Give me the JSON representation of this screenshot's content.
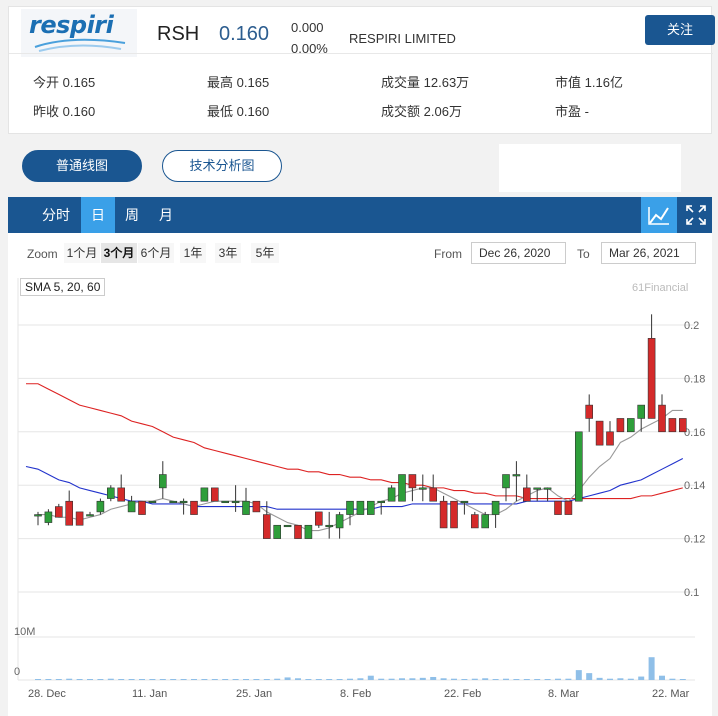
{
  "header": {
    "logo_text": "respiri",
    "ticker": "RSH",
    "price": "0.160",
    "change": "0.000",
    "change_pct": "0.00%",
    "company": "RESPIRI LIMITED",
    "follow_label": "关注",
    "stats": [
      {
        "label": "今开",
        "value": "0.165"
      },
      {
        "label": "最高",
        "value": "0.165"
      },
      {
        "label": "成交量",
        "value": "12.63万"
      },
      {
        "label": "市值",
        "value": "1.16亿"
      },
      {
        "label": "昨收",
        "value": "0.160"
      },
      {
        "label": "最低",
        "value": "0.160"
      },
      {
        "label": "成交额",
        "value": "2.06万"
      },
      {
        "label": "市盈",
        "value": "-"
      }
    ]
  },
  "chart_type_buttons": [
    "普通线图",
    "技术分析图"
  ],
  "nav": {
    "tabs": [
      "分时",
      "日",
      "周",
      "月"
    ],
    "selected": "日",
    "icons": [
      "line-chart-icon",
      "fullscreen-icon"
    ]
  },
  "zoom": {
    "label": "Zoom",
    "options": [
      "1个月",
      "3个月",
      "6个月",
      "1年",
      "3年",
      "5年"
    ],
    "selected": "3个月",
    "from_label": "From",
    "from_value": "Dec 26, 2020",
    "to_label": "To",
    "to_value": "Mar 26, 2021"
  },
  "indicator_label": "SMA 5, 20, 60",
  "credit": "61Financial",
  "colors": {
    "up": "#2e9e3a",
    "down": "#d42a2a",
    "brand": "#1a5691",
    "accent": "#3aa0e8",
    "sma5": "#999999",
    "sma20": "#2233cc",
    "sma60": "#dd2222",
    "volume": "#8fbfe8"
  },
  "chart_data": {
    "type": "candlestick",
    "x_ticks": [
      "28. Dec",
      "11. Jan",
      "25. Jan",
      "8. Feb",
      "22. Feb",
      "8. Mar",
      "22. Mar"
    ],
    "y_ticks": [
      "0.2",
      "0.18",
      "0.16",
      "0.14",
      "0.12",
      "0.1"
    ],
    "ylim": [
      0.1,
      0.21
    ],
    "volume_ticks": [
      "10M",
      "0"
    ],
    "volume_max": 10,
    "candles": [
      {
        "o": 0.129,
        "h": 0.13,
        "l": 0.125,
        "c": 0.129
      },
      {
        "o": 0.126,
        "h": 0.131,
        "l": 0.125,
        "c": 0.13
      },
      {
        "o": 0.132,
        "h": 0.133,
        "l": 0.128,
        "c": 0.128
      },
      {
        "o": 0.134,
        "h": 0.138,
        "l": 0.125,
        "c": 0.125
      },
      {
        "o": 0.13,
        "h": 0.13,
        "l": 0.125,
        "c": 0.125
      },
      {
        "o": 0.129,
        "h": 0.13,
        "l": 0.129,
        "c": 0.129
      },
      {
        "o": 0.13,
        "h": 0.135,
        "l": 0.129,
        "c": 0.134
      },
      {
        "o": 0.135,
        "h": 0.14,
        "l": 0.134,
        "c": 0.139
      },
      {
        "o": 0.139,
        "h": 0.144,
        "l": 0.134,
        "c": 0.134
      },
      {
        "o": 0.13,
        "h": 0.136,
        "l": 0.13,
        "c": 0.134
      },
      {
        "o": 0.134,
        "h": 0.134,
        "l": 0.129,
        "c": 0.129
      },
      {
        "o": 0.134,
        "h": 0.134,
        "l": 0.134,
        "c": 0.134
      },
      {
        "o": 0.139,
        "h": 0.149,
        "l": 0.135,
        "c": 0.144
      },
      {
        "o": 0.134,
        "h": 0.134,
        "l": 0.134,
        "c": 0.134
      },
      {
        "o": 0.134,
        "h": 0.135,
        "l": 0.129,
        "c": 0.134
      },
      {
        "o": 0.134,
        "h": 0.134,
        "l": 0.129,
        "c": 0.129
      },
      {
        "o": 0.134,
        "h": 0.139,
        "l": 0.134,
        "c": 0.139
      },
      {
        "o": 0.139,
        "h": 0.139,
        "l": 0.134,
        "c": 0.134
      },
      {
        "o": 0.134,
        "h": 0.134,
        "l": 0.134,
        "c": 0.134
      },
      {
        "o": 0.134,
        "h": 0.14,
        "l": 0.13,
        "c": 0.134
      },
      {
        "o": 0.129,
        "h": 0.139,
        "l": 0.129,
        "c": 0.134
      },
      {
        "o": 0.134,
        "h": 0.134,
        "l": 0.13,
        "c": 0.13
      },
      {
        "o": 0.129,
        "h": 0.134,
        "l": 0.12,
        "c": 0.12
      },
      {
        "o": 0.12,
        "h": 0.125,
        "l": 0.12,
        "c": 0.125
      },
      {
        "o": 0.125,
        "h": 0.125,
        "l": 0.125,
        "c": 0.125
      },
      {
        "o": 0.125,
        "h": 0.125,
        "l": 0.12,
        "c": 0.12
      },
      {
        "o": 0.12,
        "h": 0.125,
        "l": 0.12,
        "c": 0.125
      },
      {
        "o": 0.13,
        "h": 0.13,
        "l": 0.124,
        "c": 0.125
      },
      {
        "o": 0.125,
        "h": 0.13,
        "l": 0.12,
        "c": 0.125
      },
      {
        "o": 0.124,
        "h": 0.13,
        "l": 0.12,
        "c": 0.129
      },
      {
        "o": 0.129,
        "h": 0.134,
        "l": 0.125,
        "c": 0.134
      },
      {
        "o": 0.129,
        "h": 0.134,
        "l": 0.129,
        "c": 0.134
      },
      {
        "o": 0.129,
        "h": 0.134,
        "l": 0.129,
        "c": 0.134
      },
      {
        "o": 0.134,
        "h": 0.134,
        "l": 0.129,
        "c": 0.134
      },
      {
        "o": 0.134,
        "h": 0.14,
        "l": 0.134,
        "c": 0.139
      },
      {
        "o": 0.134,
        "h": 0.144,
        "l": 0.134,
        "c": 0.144
      },
      {
        "o": 0.144,
        "h": 0.144,
        "l": 0.134,
        "c": 0.139
      },
      {
        "o": 0.139,
        "h": 0.144,
        "l": 0.134,
        "c": 0.139
      },
      {
        "o": 0.139,
        "h": 0.144,
        "l": 0.134,
        "c": 0.134
      },
      {
        "o": 0.134,
        "h": 0.136,
        "l": 0.124,
        "c": 0.124
      },
      {
        "o": 0.134,
        "h": 0.134,
        "l": 0.124,
        "c": 0.124
      },
      {
        "o": 0.134,
        "h": 0.134,
        "l": 0.129,
        "c": 0.134
      },
      {
        "o": 0.129,
        "h": 0.13,
        "l": 0.124,
        "c": 0.124
      },
      {
        "o": 0.124,
        "h": 0.13,
        "l": 0.124,
        "c": 0.129
      },
      {
        "o": 0.129,
        "h": 0.134,
        "l": 0.124,
        "c": 0.134
      },
      {
        "o": 0.139,
        "h": 0.144,
        "l": 0.134,
        "c": 0.144
      },
      {
        "o": 0.144,
        "h": 0.149,
        "l": 0.134,
        "c": 0.144
      },
      {
        "o": 0.139,
        "h": 0.144,
        "l": 0.134,
        "c": 0.134
      },
      {
        "o": 0.139,
        "h": 0.139,
        "l": 0.134,
        "c": 0.139
      },
      {
        "o": 0.139,
        "h": 0.139,
        "l": 0.134,
        "c": 0.139
      },
      {
        "o": 0.134,
        "h": 0.134,
        "l": 0.129,
        "c": 0.129
      },
      {
        "o": 0.134,
        "h": 0.134,
        "l": 0.129,
        "c": 0.129
      },
      {
        "o": 0.134,
        "h": 0.16,
        "l": 0.134,
        "c": 0.16
      },
      {
        "o": 0.17,
        "h": 0.174,
        "l": 0.16,
        "c": 0.165
      },
      {
        "o": 0.164,
        "h": 0.164,
        "l": 0.155,
        "c": 0.155
      },
      {
        "o": 0.16,
        "h": 0.164,
        "l": 0.155,
        "c": 0.155
      },
      {
        "o": 0.165,
        "h": 0.165,
        "l": 0.16,
        "c": 0.16
      },
      {
        "o": 0.16,
        "h": 0.165,
        "l": 0.16,
        "c": 0.165
      },
      {
        "o": 0.165,
        "h": 0.17,
        "l": 0.16,
        "c": 0.17
      },
      {
        "o": 0.195,
        "h": 0.204,
        "l": 0.165,
        "c": 0.165
      },
      {
        "o": 0.17,
        "h": 0.174,
        "l": 0.16,
        "c": 0.16
      },
      {
        "o": 0.165,
        "h": 0.165,
        "l": 0.16,
        "c": 0.16
      },
      {
        "o": 0.165,
        "h": 0.165,
        "l": 0.16,
        "c": 0.16
      }
    ],
    "volumes": [
      0.05,
      0.05,
      0.1,
      0.3,
      0.05,
      0.05,
      0.2,
      0.3,
      0.1,
      0.05,
      0.1,
      0.05,
      0.2,
      0.05,
      0.1,
      0.2,
      0.1,
      0.1,
      0.05,
      0.05,
      0.1,
      0.2,
      0.2,
      0.3,
      0.6,
      0.4,
      0.1,
      0.1,
      0.05,
      0.1,
      0.3,
      0.4,
      1.0,
      0.3,
      0.3,
      0.4,
      0.4,
      0.5,
      0.7,
      0.4,
      0.3,
      0.2,
      0.3,
      0.4,
      0.2,
      0.3,
      0.2,
      0.05,
      0.2,
      0.2,
      0.3,
      0.3,
      2.3,
      1.6,
      0.5,
      0.3,
      0.4,
      0.3,
      0.8,
      5.3,
      1.0,
      0.3,
      0.2
    ],
    "sma5": [
      0.129,
      0.129,
      0.128,
      0.128,
      0.127,
      0.128,
      0.129,
      0.131,
      0.132,
      0.133,
      0.134,
      0.134,
      0.135,
      0.134,
      0.133,
      0.132,
      0.133,
      0.134,
      0.134,
      0.134,
      0.134,
      0.133,
      0.13,
      0.128,
      0.126,
      0.125,
      0.123,
      0.123,
      0.124,
      0.126,
      0.128,
      0.13,
      0.132,
      0.134,
      0.135,
      0.137,
      0.138,
      0.139,
      0.139,
      0.137,
      0.135,
      0.133,
      0.131,
      0.129,
      0.129,
      0.131,
      0.134,
      0.136,
      0.138,
      0.139,
      0.136,
      0.134,
      0.138,
      0.143,
      0.147,
      0.15,
      0.156,
      0.158,
      0.161,
      0.163,
      0.165,
      0.168,
      0.168
    ],
    "sma20": [
      0.146,
      0.144,
      0.142,
      0.141,
      0.139,
      0.138,
      0.137,
      0.136,
      0.135,
      0.134,
      0.134,
      0.133,
      0.133,
      0.133,
      0.133,
      0.132,
      0.132,
      0.132,
      0.132,
      0.132,
      0.132,
      0.132,
      0.132,
      0.131,
      0.131,
      0.131,
      0.131,
      0.131,
      0.131,
      0.131,
      0.131,
      0.131,
      0.131,
      0.132,
      0.132,
      0.132,
      0.133,
      0.133,
      0.133,
      0.133,
      0.133,
      0.133,
      0.133,
      0.133,
      0.133,
      0.133,
      0.133,
      0.134,
      0.134,
      0.134,
      0.134,
      0.134,
      0.135,
      0.136,
      0.137,
      0.138,
      0.14,
      0.141,
      0.142,
      0.144,
      0.146,
      0.148,
      0.15
    ],
    "sma60": [
      0.178,
      0.176,
      0.174,
      0.172,
      0.17,
      0.169,
      0.168,
      0.167,
      0.166,
      0.164,
      0.163,
      0.162,
      0.16,
      0.158,
      0.157,
      0.156,
      0.154,
      0.153,
      0.152,
      0.151,
      0.15,
      0.149,
      0.148,
      0.147,
      0.146,
      0.146,
      0.145,
      0.145,
      0.144,
      0.144,
      0.143,
      0.143,
      0.142,
      0.142,
      0.141,
      0.141,
      0.14,
      0.14,
      0.139,
      0.139,
      0.138,
      0.138,
      0.137,
      0.137,
      0.136,
      0.136,
      0.136,
      0.135,
      0.135,
      0.135,
      0.135,
      0.135,
      0.135,
      0.135,
      0.135,
      0.135,
      0.135,
      0.135,
      0.136,
      0.136,
      0.137,
      0.138,
      0.139
    ]
  }
}
